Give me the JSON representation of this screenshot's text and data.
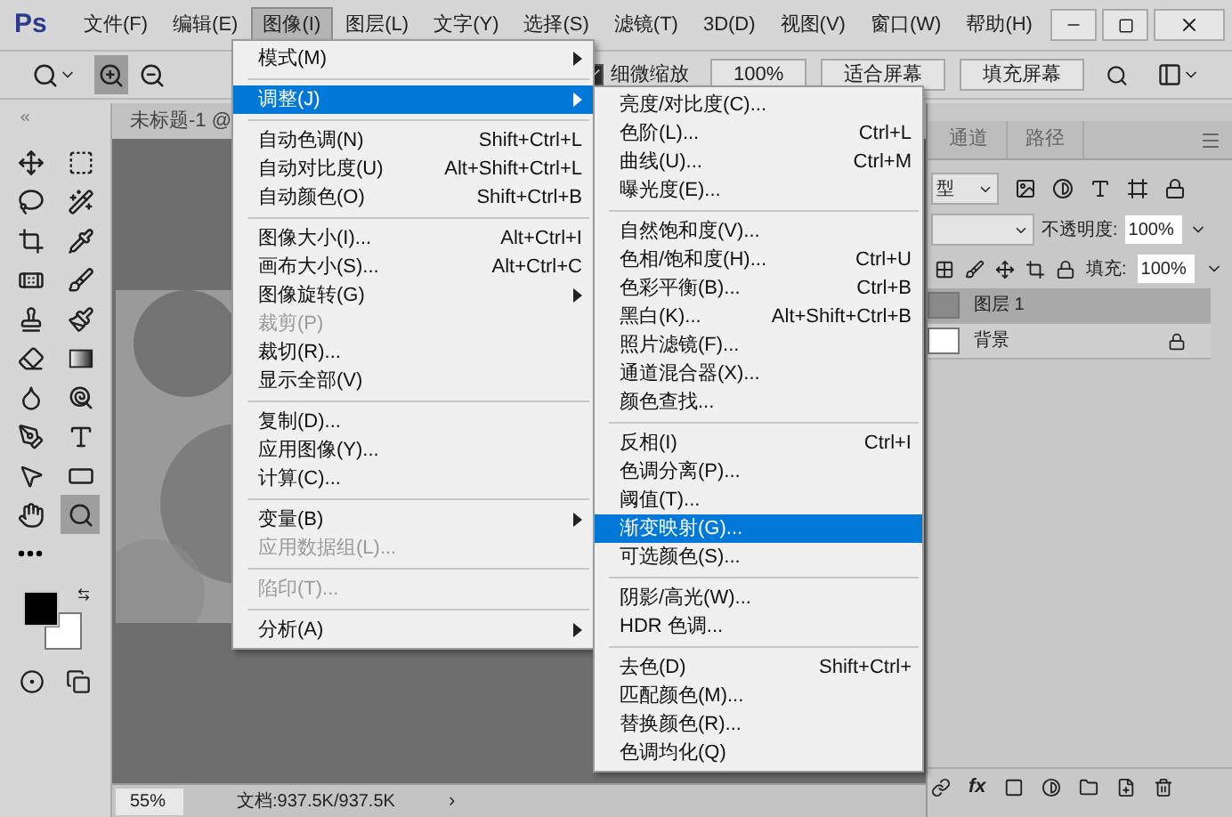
{
  "app": {
    "logo": "Ps"
  },
  "menubar": [
    {
      "label": "文件(F)",
      "selected": false
    },
    {
      "label": "编辑(E)",
      "selected": false
    },
    {
      "label": "图像(I)",
      "selected": true
    },
    {
      "label": "图层(L)",
      "selected": false
    },
    {
      "label": "文字(Y)",
      "selected": false
    },
    {
      "label": "选择(S)",
      "selected": false
    },
    {
      "label": "滤镜(T)",
      "selected": false
    },
    {
      "label": "3D(D)",
      "selected": false
    },
    {
      "label": "视图(V)",
      "selected": false
    },
    {
      "label": "窗口(W)",
      "selected": false
    },
    {
      "label": "帮助(H)",
      "selected": false
    }
  ],
  "options_bar": {
    "zoom_in": {
      "selected": true
    },
    "zoom_out": {
      "selected": false
    },
    "scrubby_zoom": {
      "label": "细微缩放",
      "checked": true
    },
    "buttons": [
      "100%",
      "适合屏幕",
      "填充屏幕"
    ]
  },
  "toolbar": {
    "tools": [
      {
        "kind": "move",
        "selected": false
      },
      {
        "kind": "marquee",
        "selected": false
      },
      {
        "kind": "lasso",
        "selected": false
      },
      {
        "kind": "wand",
        "selected": false
      },
      {
        "kind": "crop",
        "selected": false
      },
      {
        "kind": "eyedropper",
        "selected": false
      },
      {
        "kind": "healing",
        "selected": false
      },
      {
        "kind": "brush",
        "selected": false
      },
      {
        "kind": "stamp",
        "selected": false
      },
      {
        "kind": "history",
        "selected": false
      },
      {
        "kind": "eraser",
        "selected": false
      },
      {
        "kind": "gradient",
        "selected": false
      },
      {
        "kind": "blur",
        "selected": false
      },
      {
        "kind": "dodge",
        "selected": false
      },
      {
        "kind": "pen",
        "selected": false
      },
      {
        "kind": "type",
        "selected": false
      },
      {
        "kind": "select",
        "selected": false
      },
      {
        "kind": "shape",
        "selected": false
      },
      {
        "kind": "hand",
        "selected": false
      },
      {
        "kind": "zoom",
        "selected": true
      },
      {
        "kind": "more",
        "selected": false
      }
    ]
  },
  "document": {
    "tab": "未标题-1 @",
    "zoom": "55%",
    "info": "文档:937.5K/937.5K",
    "more": "›"
  },
  "image_menu": [
    [
      {
        "label": "模式(M)",
        "submenu": true,
        "disabled": false,
        "selected": false
      }
    ],
    [
      {
        "label": "调整(J)",
        "submenu": true,
        "disabled": false,
        "selected": true
      }
    ],
    [
      {
        "label": "自动色调(N)",
        "shortcut": "Shift+Ctrl+L",
        "disabled": false,
        "selected": false
      },
      {
        "label": "自动对比度(U)",
        "shortcut": "Alt+Shift+Ctrl+L",
        "disabled": false,
        "selected": false
      },
      {
        "label": "自动颜色(O)",
        "shortcut": "Shift+Ctrl+B",
        "disabled": false,
        "selected": false
      }
    ],
    [
      {
        "label": "图像大小(I)...",
        "shortcut": "Alt+Ctrl+I",
        "disabled": false,
        "selected": false
      },
      {
        "label": "画布大小(S)...",
        "shortcut": "Alt+Ctrl+C",
        "disabled": false,
        "selected": false
      },
      {
        "label": "图像旋转(G)",
        "submenu": true,
        "disabled": false,
        "selected": false
      },
      {
        "label": "裁剪(P)",
        "disabled": true,
        "selected": false
      },
      {
        "label": "裁切(R)...",
        "disabled": false,
        "selected": false
      },
      {
        "label": "显示全部(V)",
        "disabled": false,
        "selected": false
      }
    ],
    [
      {
        "label": "复制(D)...",
        "disabled": false,
        "selected": false
      },
      {
        "label": "应用图像(Y)...",
        "disabled": false,
        "selected": false
      },
      {
        "label": "计算(C)...",
        "disabled": false,
        "selected": false
      }
    ],
    [
      {
        "label": "变量(B)",
        "submenu": true,
        "disabled": false,
        "selected": false
      },
      {
        "label": "应用数据组(L)...",
        "disabled": true,
        "selected": false
      }
    ],
    [
      {
        "label": "陷印(T)...",
        "disabled": true,
        "selected": false
      }
    ],
    [
      {
        "label": "分析(A)",
        "submenu": true,
        "disabled": false,
        "selected": false
      }
    ]
  ],
  "adjust_menu": [
    [
      {
        "label": "亮度/对比度(C)...",
        "selected": false
      },
      {
        "label": "色阶(L)...",
        "shortcut": "Ctrl+L",
        "selected": false
      },
      {
        "label": "曲线(U)...",
        "shortcut": "Ctrl+M",
        "selected": false
      },
      {
        "label": "曝光度(E)...",
        "selected": false
      }
    ],
    [
      {
        "label": "自然饱和度(V)...",
        "selected": false
      },
      {
        "label": "色相/饱和度(H)...",
        "shortcut": "Ctrl+U",
        "selected": false
      },
      {
        "label": "色彩平衡(B)...",
        "shortcut": "Ctrl+B",
        "selected": false
      },
      {
        "label": "黑白(K)...",
        "shortcut": "Alt+Shift+Ctrl+B",
        "selected": false
      },
      {
        "label": "照片滤镜(F)...",
        "selected": false
      },
      {
        "label": "通道混合器(X)...",
        "selected": false
      },
      {
        "label": "颜色查找...",
        "selected": false
      }
    ],
    [
      {
        "label": "反相(I)",
        "shortcut": "Ctrl+I",
        "selected": false
      },
      {
        "label": "色调分离(P)...",
        "selected": false
      },
      {
        "label": "阈值(T)...",
        "selected": false
      },
      {
        "label": "渐变映射(G)...",
        "selected": true
      },
      {
        "label": "可选颜色(S)...",
        "selected": false
      }
    ],
    [
      {
        "label": "阴影/高光(W)...",
        "selected": false
      },
      {
        "label": "HDR 色调...",
        "selected": false
      }
    ],
    [
      {
        "label": "去色(D)",
        "shortcut": "Shift+Ctrl+",
        "selected": false
      },
      {
        "label": "匹配颜色(M)...",
        "selected": false
      },
      {
        "label": "替换颜色(R)...",
        "selected": false
      },
      {
        "label": "色调均化(Q)",
        "selected": false
      }
    ]
  ],
  "layers_panel": {
    "tabs": [
      {
        "label": "通道",
        "selected": false
      },
      {
        "label": "路径",
        "selected": false
      }
    ],
    "filter": "型",
    "opacity_label": "不透明度:",
    "opacity": "100%",
    "fill_label": "填充:",
    "fill": "100%",
    "layers": [
      {
        "name": "图层 1",
        "selected": true,
        "kind": "texture",
        "locked": false
      },
      {
        "name": "背景",
        "selected": false,
        "kind": "white",
        "locked": true
      }
    ],
    "fx": "fx"
  }
}
